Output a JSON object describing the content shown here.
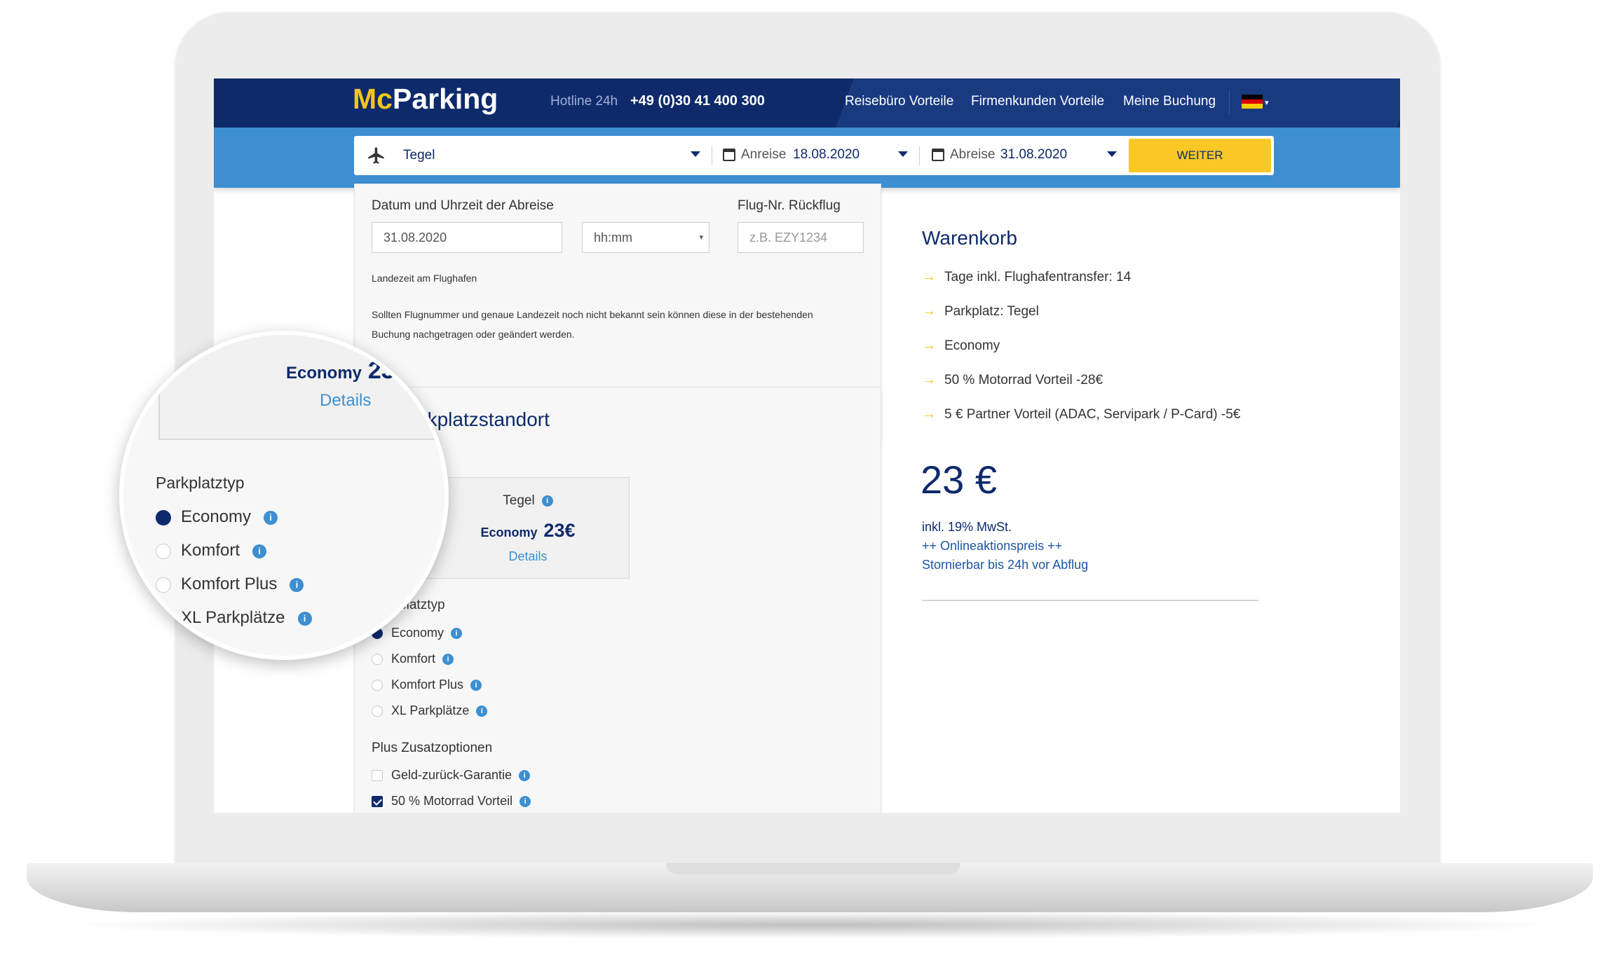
{
  "header": {
    "logo_mc": "Mc",
    "logo_parking": "Parking",
    "hotline_label": "Hotline 24h",
    "hotline_number": "+49 (0)30 41 400 300",
    "nav": [
      "Reisebüro Vorteile",
      "Firmenkunden Vorteile",
      "Meine Buchung"
    ],
    "language_flag": "flag-de-icon"
  },
  "search": {
    "airport": "Tegel",
    "arrival_label": "Anreise",
    "arrival_date": "18.08.2020",
    "departure_label": "Abreise",
    "departure_date": "31.08.2020",
    "submit_label": "WEITER"
  },
  "return_section": {
    "datetime_label": "Datum und Uhrzeit der Abreise",
    "date_value": "31.08.2020",
    "time_placeholder": "hh:mm",
    "flight_label": "Flug-Nr. Rückflug",
    "flight_placeholder": "z.B. EZY1234",
    "landing_hint": "Landezeit am Flughafen",
    "note_line1": "Sollten Flugnummer und genaue Landezeit noch nicht bekannt sein können diese in der bestehenden",
    "note_line2": "Buchung nachgetragen oder geändert werden."
  },
  "parking_section": {
    "title": "Parkplatzstandort",
    "card": {
      "location": "Tegel",
      "type": "Economy",
      "price": "23€",
      "details": "Details"
    },
    "type_heading": "Parkplatztyp",
    "types": [
      {
        "label": "Economy",
        "selected": true
      },
      {
        "label": "Komfort",
        "selected": false
      },
      {
        "label": "Komfort Plus",
        "selected": false
      },
      {
        "label": "XL Parkplätze",
        "selected": false
      }
    ],
    "extras_heading": "Plus Zusatzoptionen",
    "extras": [
      {
        "label": "Geld-zurück-Garantie",
        "checked": false
      },
      {
        "label": "50 % Motorrad Vorteil",
        "checked": true
      }
    ]
  },
  "cart": {
    "title": "Warenkorb",
    "items": [
      "Tage inkl. Flughafentransfer: 14",
      "Parkplatz: Tegel",
      "Economy",
      "50 % Motorrad Vorteil -28€",
      "5 € Partner Vorteil (ADAC, Servipark / P-Card) -5€"
    ],
    "total": "23 €",
    "vat": "inkl. 19% MwSt.",
    "online_price": "++ Onlineaktionspreis ++",
    "cancel": "Stornierbar bis 24h vor Abflug"
  },
  "colors": {
    "brand_navy": "#0e2a6b",
    "brand_blue": "#3d8fd1",
    "accent_yellow": "#f9c825"
  }
}
